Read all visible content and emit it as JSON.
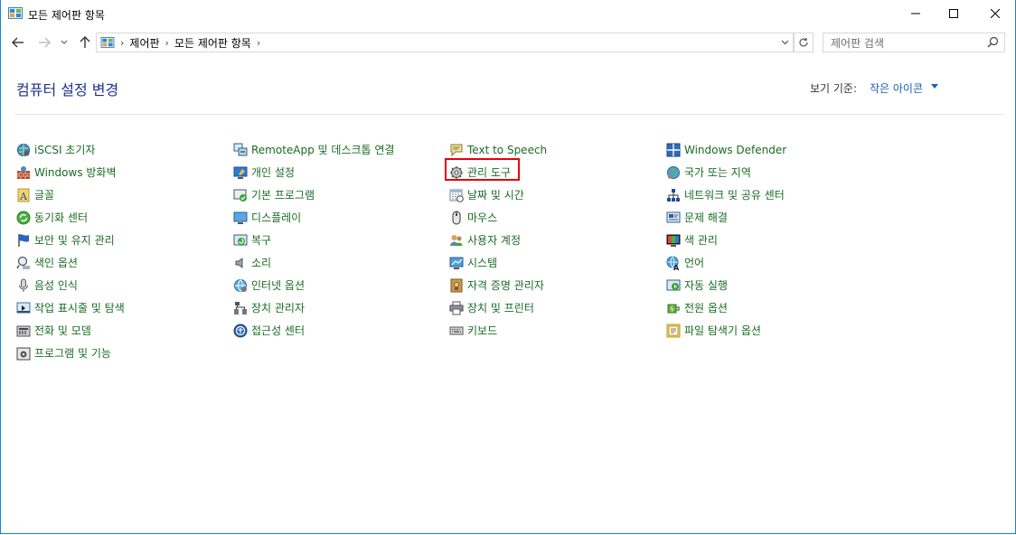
{
  "window": {
    "title": "모든 제어판 항목"
  },
  "address_bar": {
    "crumbs": [
      "제어판",
      "모든 제어판 항목"
    ]
  },
  "search": {
    "placeholder": "제어판 검색"
  },
  "header": {
    "title": "컴퓨터 설정 변경",
    "view_by_label": "보기 기준:",
    "view_by_value": "작은 아이콘"
  },
  "items": {
    "col1": [
      {
        "label": "iSCSI 초기자",
        "icon": "iscsi-globe-icon"
      },
      {
        "label": "Windows 방화벽",
        "icon": "firewall-icon"
      },
      {
        "label": "글꼴",
        "icon": "fonts-icon"
      },
      {
        "label": "동기화 센터",
        "icon": "sync-center-icon"
      },
      {
        "label": "보안 및 유지 관리",
        "icon": "flag-icon"
      },
      {
        "label": "색인 옵션",
        "icon": "indexing-icon"
      },
      {
        "label": "음성 인식",
        "icon": "microphone-icon"
      },
      {
        "label": "작업 표시줄 및 탐색",
        "icon": "taskbar-icon"
      },
      {
        "label": "전화 및 모뎀",
        "icon": "phone-modem-icon"
      },
      {
        "label": "프로그램 및 기능",
        "icon": "programs-icon"
      }
    ],
    "col2": [
      {
        "label": "RemoteApp 및 데스크톱 연결",
        "icon": "remoteapp-icon"
      },
      {
        "label": "개인 설정",
        "icon": "personalization-icon"
      },
      {
        "label": "기본 프로그램",
        "icon": "default-programs-icon"
      },
      {
        "label": "디스플레이",
        "icon": "display-icon"
      },
      {
        "label": "복구",
        "icon": "recovery-icon"
      },
      {
        "label": "소리",
        "icon": "sound-icon"
      },
      {
        "label": "인터넷 옵션",
        "icon": "internet-options-icon"
      },
      {
        "label": "장치 관리자",
        "icon": "device-manager-icon"
      },
      {
        "label": "접근성 센터",
        "icon": "ease-of-access-icon"
      }
    ],
    "col3": [
      {
        "label": "Text to Speech",
        "icon": "text-to-speech-icon"
      },
      {
        "label": "관리 도구",
        "icon": "admin-tools-icon"
      },
      {
        "label": "날짜 및 시간",
        "icon": "date-time-icon"
      },
      {
        "label": "마우스",
        "icon": "mouse-icon"
      },
      {
        "label": "사용자 계정",
        "icon": "user-accounts-icon"
      },
      {
        "label": "시스템",
        "icon": "system-icon"
      },
      {
        "label": "자격 증명 관리자",
        "icon": "credential-manager-icon"
      },
      {
        "label": "장치 및 프린터",
        "icon": "devices-printers-icon"
      },
      {
        "label": "키보드",
        "icon": "keyboard-icon"
      }
    ],
    "col4": [
      {
        "label": "Windows Defender",
        "icon": "defender-icon"
      },
      {
        "label": "국가 또는 지역",
        "icon": "region-icon"
      },
      {
        "label": "네트워크 및 공유 센터",
        "icon": "network-sharing-icon"
      },
      {
        "label": "문제 해결",
        "icon": "troubleshooting-icon"
      },
      {
        "label": "색 관리",
        "icon": "color-management-icon"
      },
      {
        "label": "언어",
        "icon": "language-icon"
      },
      {
        "label": "자동 실행",
        "icon": "autoplay-icon"
      },
      {
        "label": "전원 옵션",
        "icon": "power-options-icon"
      },
      {
        "label": "파일 탐색기 옵션",
        "icon": "file-explorer-options-icon"
      }
    ]
  },
  "highlighted_item": "관리 도구",
  "colors": {
    "link_green": "#1a6b24",
    "heading_blue": "#1e3287",
    "accent_blue": "#1a62b8",
    "highlight_red": "#e8000b"
  }
}
